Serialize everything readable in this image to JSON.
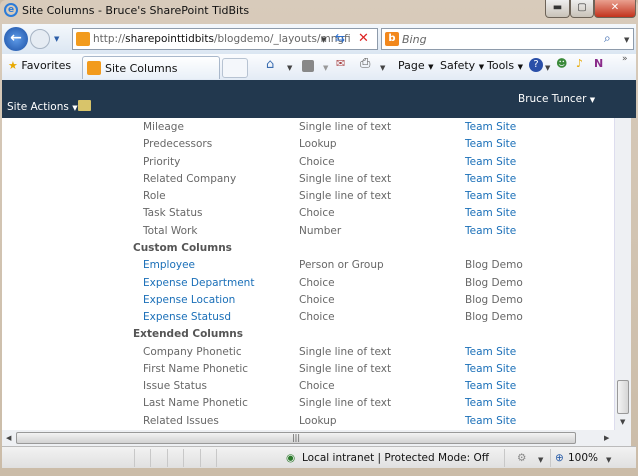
{
  "window": {
    "title": "Site Columns - Bruce's SharePoint TidBits"
  },
  "address": {
    "prefix": "http://",
    "host": "sharepointtidbits",
    "path": "/blogdemo/_layouts/mngfi"
  },
  "search": {
    "placeholder": "Bing"
  },
  "favorites_label": "Favorites",
  "tab": {
    "label": "Site Columns"
  },
  "commands": {
    "page": "Page",
    "safety": "Safety",
    "tools": "Tools"
  },
  "sharepoint": {
    "site_actions": "Site Actions",
    "user": "Bruce Tuncer"
  },
  "groups": [
    {
      "heading": "",
      "rows": [
        {
          "name": "Mileage",
          "type": "Single line of text",
          "source": "Team Site"
        },
        {
          "name": "Predecessors",
          "type": "Lookup",
          "source": "Team Site"
        },
        {
          "name": "Priority",
          "type": "Choice",
          "source": "Team Site"
        },
        {
          "name": "Related Company",
          "type": "Single line of text",
          "source": "Team Site"
        },
        {
          "name": "Role",
          "type": "Single line of text",
          "source": "Team Site"
        },
        {
          "name": "Task Status",
          "type": "Choice",
          "source": "Team Site"
        },
        {
          "name": "Total Work",
          "type": "Number",
          "source": "Team Site"
        }
      ]
    },
    {
      "heading": "Custom Columns",
      "rows": [
        {
          "name": "Employee",
          "type": "Person or Group",
          "source": "Blog Demo"
        },
        {
          "name": "Expense Department",
          "type": "Choice",
          "source": "Blog Demo"
        },
        {
          "name": "Expense Location",
          "type": "Choice",
          "source": "Blog Demo"
        },
        {
          "name": "Expense Statusd",
          "type": "Choice",
          "source": "Blog Demo"
        }
      ]
    },
    {
      "heading": "Extended Columns",
      "rows": [
        {
          "name": "Company Phonetic",
          "type": "Single line of text",
          "source": "Team Site"
        },
        {
          "name": "First Name Phonetic",
          "type": "Single line of text",
          "source": "Team Site"
        },
        {
          "name": "Issue Status",
          "type": "Choice",
          "source": "Team Site"
        },
        {
          "name": "Last Name Phonetic",
          "type": "Single line of text",
          "source": "Team Site"
        },
        {
          "name": "Related Issues",
          "type": "Lookup",
          "source": "Team Site"
        }
      ]
    }
  ],
  "status": {
    "zone": "Local intranet | Protected Mode: Off",
    "zoom": "100%"
  },
  "colors": {
    "sp_header": "#22384e",
    "link": "#1a6fb8"
  }
}
